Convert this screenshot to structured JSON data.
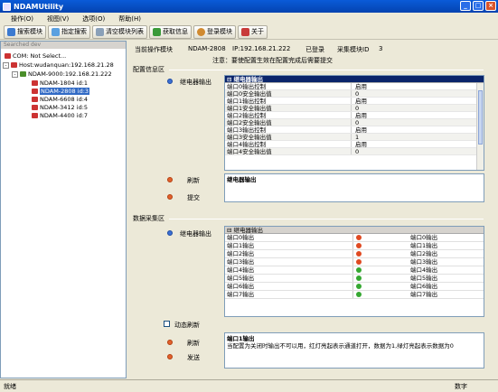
{
  "window": {
    "title": "NDAMUtility"
  },
  "menu": [
    "操作(O)",
    "视图(V)",
    "选项(O)",
    "帮助(H)"
  ],
  "toolbar": [
    "搜索模块",
    "指定搜索",
    "清空模块列表",
    "获取信息",
    "登录模块",
    "关于"
  ],
  "tree": {
    "header": "Searched dev",
    "com": "COM: Not Select...",
    "host": "Host:wudanquan:192.168.21.28",
    "module": "NDAM-9000:192.168.21.222",
    "children": [
      "NDAM-1804 id:1",
      "NDAM-2808 id:3",
      "NDAM-6608 id:4",
      "NDAM-3412 id:5",
      "NDAM-4400 id:7"
    ]
  },
  "info": {
    "current_label": "当前操作模块",
    "model": "NDAM-2808",
    "ip": "IP:192.168.21.222",
    "login": "已登录",
    "id_label": "采集模块ID",
    "id": "3",
    "notice": "注意：要使配置生效在配置完成后需要提交"
  },
  "config": {
    "section": "配置信息区",
    "row_label": "继电器输出",
    "group": "继电器输出",
    "refresh": "刷新",
    "submit": "提交",
    "desc_title": "继电器输出",
    "rows": [
      [
        "端口0输出控制",
        "启用"
      ],
      [
        "端口0安全输出值",
        "0"
      ],
      [
        "端口1输出控制",
        "启用"
      ],
      [
        "端口1安全输出值",
        "0"
      ],
      [
        "端口2输出控制",
        "启用"
      ],
      [
        "端口2安全输出值",
        "0"
      ],
      [
        "端口3输出控制",
        "启用"
      ],
      [
        "端口3安全输出值",
        "1"
      ],
      [
        "端口4输出控制",
        "启用"
      ],
      [
        "端口4安全输出值",
        "0"
      ]
    ]
  },
  "collect": {
    "section": "数据采集区",
    "row_label": "继电器输出",
    "group": "继电器输出",
    "dyn": "动态刷新",
    "refresh": "刷新",
    "send": "发送",
    "rows": [
      [
        "端口0输出",
        "端口0输出",
        "r"
      ],
      [
        "端口1输出",
        "端口1输出",
        "r"
      ],
      [
        "端口2输出",
        "端口2输出",
        "r"
      ],
      [
        "端口3输出",
        "端口3输出",
        "r"
      ],
      [
        "端口4输出",
        "端口4输出",
        "g"
      ],
      [
        "端口5输出",
        "端口5输出",
        "g"
      ],
      [
        "端口6输出",
        "端口6输出",
        "g"
      ],
      [
        "端口7输出",
        "端口7输出",
        "g"
      ]
    ],
    "desc_title": "端口1输出",
    "desc_text": "当配置为关闭时输出不可以用，红灯亮起表示通道打开，数据为1,绿灯亮起表示数据为0"
  },
  "status": {
    "left": "就绪",
    "right": "数字"
  }
}
